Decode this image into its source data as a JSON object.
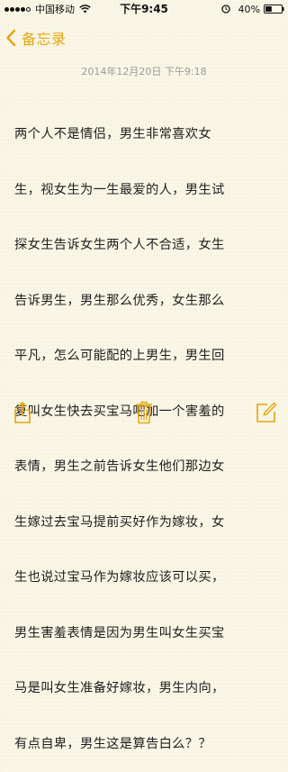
{
  "status_bar": {
    "carrier": "中国移动",
    "time": "下午9:45",
    "battery_percent": "40%",
    "battery_level": 0.4,
    "signal_strength": 4,
    "icons": [
      "signal-icon",
      "wifi-icon",
      "alarm-icon",
      "battery-icon"
    ]
  },
  "nav": {
    "back_label": "备忘录",
    "back_icon": "chevron-left-icon",
    "accent_color": "#e4a60f"
  },
  "note": {
    "date": "2014年12月20日  下午9:18",
    "lines": [
      "两个人不是情侣，男生非常喜欢女",
      "生，视女生为一生最爱的人，男生试",
      "探女生告诉女生两个人不合适，女生",
      "告诉男生，男生那么优秀，女生那么",
      "平凡，怎么可能配的上男生，男生回",
      "复叫女生快去买宝马吧加一个害羞的",
      "表情，男生之前告诉女生他们那边女",
      "生嫁过去宝马提前买好作为嫁妆，女",
      "生也说过宝马作为嫁妆应该可以买，",
      "男生害羞表情是因为男生叫女生买宝",
      "马是叫女生准备好嫁妆，男生内向，",
      "有点自卑，男生这是算告白么？？"
    ]
  },
  "toolbar": {
    "icons": [
      "share-icon",
      "trash-icon",
      "compose-icon"
    ],
    "icon_color": "#e4a60f"
  },
  "colors": {
    "paper": "#fbf8e8",
    "text": "#1e1e1e",
    "date_text": "#9a9a9a"
  }
}
